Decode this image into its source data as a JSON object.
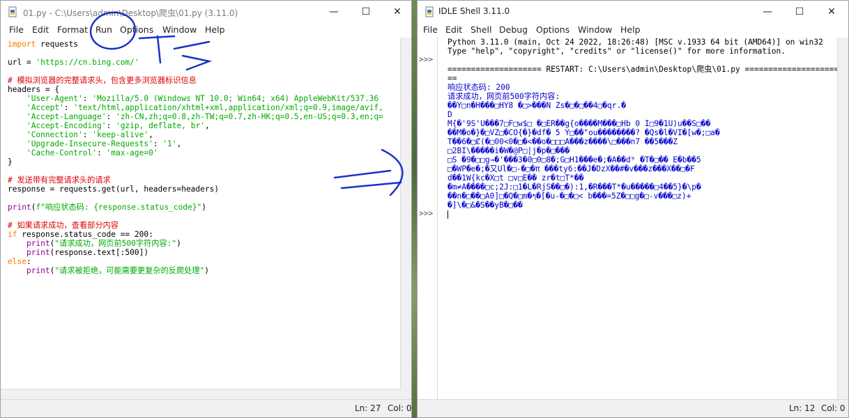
{
  "editor": {
    "title": "01.py - C:\\Users\\admin\\Desktop\\爬虫\\01.py (3.11.0)",
    "menu": [
      "File",
      "Edit",
      "Format",
      "Run",
      "Options",
      "Window",
      "Help"
    ],
    "status_ln": "Ln: 27",
    "status_col": "Col: 0",
    "lines": [
      [
        {
          "t": "import",
          "c": "kw"
        },
        {
          "t": " requests",
          "c": "plain"
        }
      ],
      [],
      [
        {
          "t": "url = ",
          "c": "plain"
        },
        {
          "t": "'https://cn.bing.com/'",
          "c": "str"
        }
      ],
      [],
      [
        {
          "t": "# 模拟浏览器的完整请求头，包含更多浏览器标识信息",
          "c": "cm"
        }
      ],
      [
        {
          "t": "headers = {",
          "c": "plain"
        }
      ],
      [
        {
          "t": "    ",
          "c": "plain"
        },
        {
          "t": "'User-Agent'",
          "c": "str"
        },
        {
          "t": ": ",
          "c": "plain"
        },
        {
          "t": "'Mozilla/5.0 (Windows NT 10.0; Win64; x64) AppleWebKit/537.36",
          "c": "str"
        }
      ],
      [
        {
          "t": "    ",
          "c": "plain"
        },
        {
          "t": "'Accept'",
          "c": "str"
        },
        {
          "t": ": ",
          "c": "plain"
        },
        {
          "t": "'text/html,application/xhtml+xml,application/xml;q=0.9,image/avif,",
          "c": "str"
        }
      ],
      [
        {
          "t": "    ",
          "c": "plain"
        },
        {
          "t": "'Accept-Language'",
          "c": "str"
        },
        {
          "t": ": ",
          "c": "plain"
        },
        {
          "t": "'zh-CN,zh;q=0.8,zh-TW;q=0.7,zh-HK;q=0.5,en-US;q=0.3,en;q=",
          "c": "str"
        }
      ],
      [
        {
          "t": "    ",
          "c": "plain"
        },
        {
          "t": "'Accept-Encoding'",
          "c": "str"
        },
        {
          "t": ": ",
          "c": "plain"
        },
        {
          "t": "'gzip, deflate, br'",
          "c": "str"
        },
        {
          "t": ",",
          "c": "plain"
        }
      ],
      [
        {
          "t": "    ",
          "c": "plain"
        },
        {
          "t": "'Connection'",
          "c": "str"
        },
        {
          "t": ": ",
          "c": "plain"
        },
        {
          "t": "'keep-alive'",
          "c": "str"
        },
        {
          "t": ",",
          "c": "plain"
        }
      ],
      [
        {
          "t": "    ",
          "c": "plain"
        },
        {
          "t": "'Upgrade-Insecure-Requests'",
          "c": "str"
        },
        {
          "t": ": ",
          "c": "plain"
        },
        {
          "t": "'1'",
          "c": "str"
        },
        {
          "t": ",",
          "c": "plain"
        }
      ],
      [
        {
          "t": "    ",
          "c": "plain"
        },
        {
          "t": "'Cache-Control'",
          "c": "str"
        },
        {
          "t": ": ",
          "c": "plain"
        },
        {
          "t": "'max-age=0'",
          "c": "str"
        }
      ],
      [
        {
          "t": "}",
          "c": "plain"
        }
      ],
      [],
      [
        {
          "t": "# 发送带有完整请求头的请求",
          "c": "cm"
        }
      ],
      [
        {
          "t": "response = requests.get(url, headers=headers)",
          "c": "plain"
        }
      ],
      [],
      [
        {
          "t": "print",
          "c": "bi"
        },
        {
          "t": "(",
          "c": "plain"
        },
        {
          "t": "f\"响应状态码: {response.status_code}\"",
          "c": "str"
        },
        {
          "t": ")",
          "c": "plain"
        }
      ],
      [],
      [
        {
          "t": "# 如果请求成功，查看部分内容",
          "c": "cm"
        }
      ],
      [
        {
          "t": "if",
          "c": "kw"
        },
        {
          "t": " response.status_code == 200:",
          "c": "plain"
        }
      ],
      [
        {
          "t": "    ",
          "c": "plain"
        },
        {
          "t": "print",
          "c": "bi"
        },
        {
          "t": "(",
          "c": "plain"
        },
        {
          "t": "\"请求成功，网页前500字符内容:\"",
          "c": "str"
        },
        {
          "t": ")",
          "c": "plain"
        }
      ],
      [
        {
          "t": "    ",
          "c": "plain"
        },
        {
          "t": "print",
          "c": "bi"
        },
        {
          "t": "(response.text[:500])",
          "c": "plain"
        }
      ],
      [
        {
          "t": "else",
          "c": "kw"
        },
        {
          "t": ":",
          "c": "plain"
        }
      ],
      [
        {
          "t": "    ",
          "c": "plain"
        },
        {
          "t": "print",
          "c": "bi"
        },
        {
          "t": "(",
          "c": "plain"
        },
        {
          "t": "\"请求被拒绝，可能需要更复杂的反爬处理\"",
          "c": "str"
        },
        {
          "t": ")",
          "c": "plain"
        }
      ]
    ]
  },
  "shell": {
    "title": "IDLE Shell 3.11.0",
    "menu": [
      "File",
      "Edit",
      "Shell",
      "Debug",
      "Options",
      "Window",
      "Help"
    ],
    "status_ln": "Ln: 12",
    "status_col": "Col: 0",
    "prompt": ">>>",
    "lines": [
      [
        {
          "t": "Python 3.11.0 (main, Oct 24 2022, 18:26:48) [MSC v.1933 64 bit (AMD64)] on win32",
          "c": "plain"
        }
      ],
      [
        {
          "t": "Type \"help\", \"copyright\", \"credits\" or \"license()\" for more information.",
          "c": "plain"
        }
      ],
      [],
      [
        {
          "t": "==================== RESTART: C:\\Users\\admin\\Desktop\\爬虫\\01.py ====================",
          "c": "plain"
        }
      ],
      [
        {
          "t": "==",
          "c": "plain"
        }
      ],
      [
        {
          "t": "响应状态码: 200",
          "c": "out"
        }
      ],
      [
        {
          "t": "请求成功，网页前500字符内容:",
          "c": "out"
        }
      ],
      [
        {
          "t": "��Y□n�H���□HY8 �□>���N Zs�□�□��4□�qr.�",
          "c": "out"
        }
      ],
      [
        {
          "t": "D",
          "c": "out"
        }
      ],
      [
        {
          "t": "M{�'9S'U���7□F□w$□ �□ER��g{o����M���□Hb 0 I□9�1U)u��S□��",
          "c": "out"
        }
      ],
      [
        {
          "t": "��M�o�}�□VZ□�CO{�}�df� 5 Y□��\"ou��������? �Qs�l�VI�[w�;□a�",
          "c": "out"
        }
      ],
      [
        {
          "t": "T��6�□Ȼ(�□00<0�□�<��o�□□□A���z����\\□���n7 ��5���Z",
          "c": "out"
        }
      ],
      [
        {
          "t": "□2BI\\�����i�W�@P□|j�p�□���",
          "c": "out"
        }
      ],
      [
        {
          "t": "□S �9�□□g→�'���3�0□0□8�;G□H1���e�;�A��d⁹ �T�□�� E�b��5",
          "c": "out"
        }
      ],
      [
        {
          "t": "□�WP�e�;�又Ul�□-�□�π ���ty6:��J�DzX��#�v���z���X��□�F",
          "c": "out"
        }
      ],
      [
        {
          "t": "d��1W{kc�X□t □v□E�� zr�t□T*��",
          "c": "out"
        }
      ],
      [
        {
          "t": "�m≠A����□c;2J:□1�L�RjS��□�):1,�R���T*�u�����□4��5}�\\p�",
          "c": "out"
        }
      ],
      [
        {
          "t": "��n�□��□A0]□�Q�□m�ๆ�[�u-�□�□< b���=5Z�□□g�□-v���□z)+",
          "c": "out"
        }
      ],
      [
        {
          "t": "�]\\�□&�S��yB�□��",
          "c": "out"
        }
      ],
      [
        {
          "t": "",
          "c": "plain"
        }
      ]
    ]
  }
}
